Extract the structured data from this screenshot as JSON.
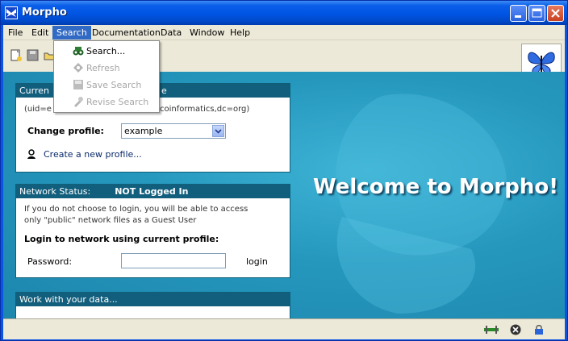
{
  "window": {
    "title": "Morpho",
    "icon": "butterfly-icon"
  },
  "menu": {
    "items": [
      "File",
      "Edit",
      "Search",
      "Documentation",
      "Data",
      "Window",
      "Help"
    ],
    "active": "Search"
  },
  "search_menu": {
    "items": [
      {
        "label": "Search...",
        "enabled": true,
        "icon": "binoculars-icon"
      },
      {
        "label": "Refresh",
        "enabled": false,
        "icon": "refresh-icon"
      },
      {
        "label": "Save Search",
        "enabled": false,
        "icon": "save-search-icon"
      },
      {
        "label": "Revise Search",
        "enabled": false,
        "icon": "revise-search-icon"
      }
    ]
  },
  "profile_panel": {
    "header_start": "Curren",
    "header_end": "e",
    "dn_start": "(uid=e",
    "dn_end": "coinformatics,dc=org)",
    "change_label": "Change profile:",
    "selected_profile": "example",
    "create_link": "Create a new profile..."
  },
  "network_panel": {
    "header_label": "Network Status:",
    "status": "NOT Logged In",
    "note_line1": "If you do not choose to login, you will be able to access",
    "note_line2": "only \"public\" network files as a Guest User",
    "login_heading": "Login to network using current profile:",
    "password_label": "Password:",
    "login_button": "login"
  },
  "data_panel": {
    "header": "Work with your data..."
  },
  "welcome": {
    "text": "Welcome to Morpho!"
  },
  "colors": {
    "title_blue": "#0054e3",
    "panel_header": "#125f7d",
    "content_bg": "#2c8fb0",
    "menu_highlight": "#316ac5"
  }
}
